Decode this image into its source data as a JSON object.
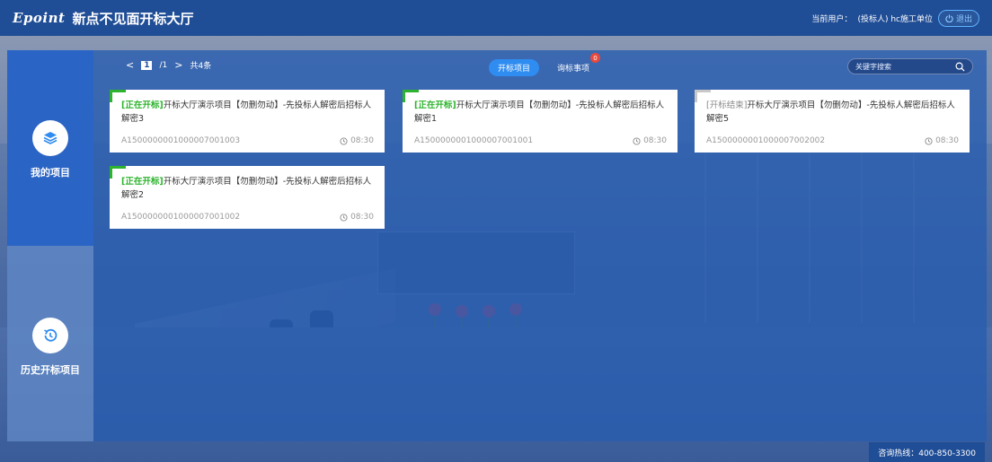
{
  "header": {
    "brand": "Epoint",
    "title": "新点不见面开标大厅",
    "current_user_label": "当前用户：",
    "current_user": "(投标人) hc施工单位",
    "logout": "退出"
  },
  "nav": {
    "items": [
      {
        "label": "我的项目",
        "icon": "layers-icon"
      },
      {
        "label": "历史开标项目",
        "icon": "history-icon"
      }
    ]
  },
  "pager": {
    "prev": "<",
    "current": "1",
    "total": "/1",
    "next": ">",
    "count": "共4条"
  },
  "tabs": [
    {
      "label": "开标项目"
    },
    {
      "label": "询标事项",
      "badge": "0"
    }
  ],
  "search": {
    "placeholder": "关键字搜索"
  },
  "cards": [
    {
      "status": "[正在开标]",
      "title": "开标大厅演示项目【勿删勿动】-先投标人解密后招标人解密3",
      "code": "A150000000100000700100 3",
      "time": "08:30"
    },
    {
      "status": "[正在开标]",
      "title": "开标大厅演示项目【勿删勿动】-先投标人解密后招标人解密1",
      "code": "A1500000001000007001001",
      "time": "08:30"
    },
    {
      "status": "[开标结束]",
      "title": "开标大厅演示项目【勿删勿动】-先投标人解密后招标人解密5",
      "code": "A1500000001000007002002",
      "time": "08:30"
    },
    {
      "status": "[正在开标]",
      "title": "开标大厅演示项目【勿删勿动】-先投标人解密后招标人解密2",
      "code": "A1500000001000007001002",
      "time": "08:30"
    }
  ],
  "hotline": "咨询热线：400-850-3300",
  "colors": {
    "header": "#1f4d96",
    "accent": "#2f8cf0",
    "status_active": "#2db32d",
    "badge": "#e8493c"
  }
}
